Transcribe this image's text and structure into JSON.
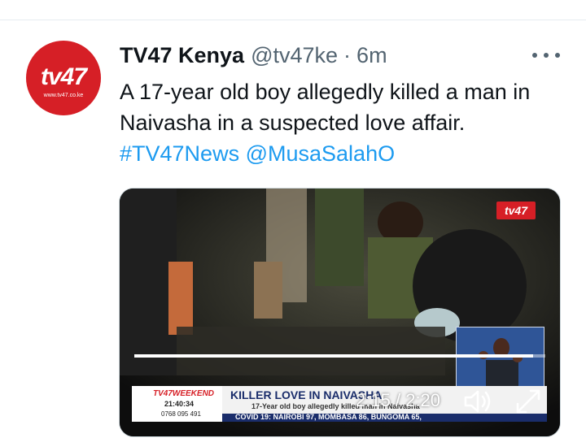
{
  "tweet": {
    "author_name": "TV47 Kenya",
    "author_handle": "@tv47ke",
    "separator": "·",
    "timestamp": "6m",
    "text_line1": "A 17-year old boy allegedly killed a man in",
    "text_line2": "Naivasha in a suspected love affair.",
    "hashtag": "#TV47News",
    "mention": "@MusaSalahO",
    "avatar": {
      "logo_text": "tv47",
      "site_text": "www.tv47.co.ke",
      "bg_color": "#d61f26"
    },
    "more_icon": "more-horizontal-icon"
  },
  "video": {
    "channel_logo": "tv47",
    "progress": 0.97,
    "current_time": "2:15",
    "time_separator": "/",
    "duration": "2:20",
    "icons": [
      "play-icon",
      "volume-icon",
      "fullscreen-icon"
    ],
    "lower_third": {
      "brand": "TV47WEEKEND",
      "clock": "21:40:34",
      "phone": "0768 095 491",
      "headline": "KILLER LOVE IN NAIVASHA",
      "subline": "17-Year old boy allegedly killed man in Naivasha",
      "ticker": "COVID 19: NAIROBI 97, MOMBASA 86, BUNGOMA 65,"
    }
  },
  "colors": {
    "link": "#1d9bf0",
    "secondary_text": "#536471",
    "brand_red": "#d61f26"
  }
}
